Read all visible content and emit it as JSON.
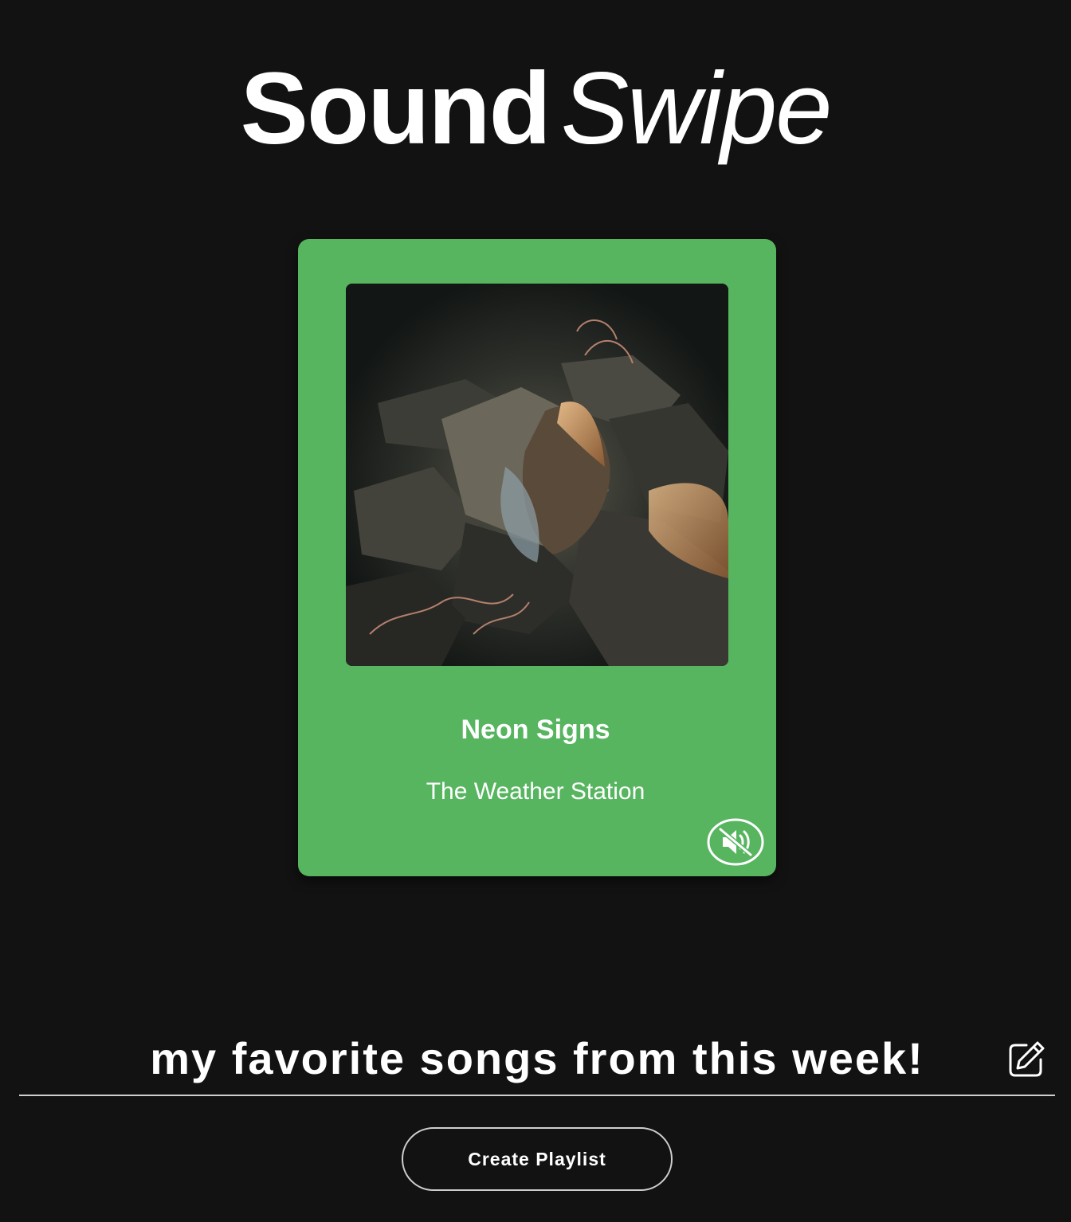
{
  "app": {
    "logo_part1": "Sound",
    "logo_part2": "Swipe"
  },
  "card": {
    "background_color": "#57b560",
    "cover_alt": "Album cover",
    "song_title": "Neon Signs",
    "artist": "The Weather Station",
    "audio_state": "muted",
    "audio_icon": "speaker-muted-icon"
  },
  "playlist": {
    "name_value": "my favorite songs from this week!",
    "edit_icon": "pencil-edit-icon",
    "create_label": "Create Playlist"
  }
}
